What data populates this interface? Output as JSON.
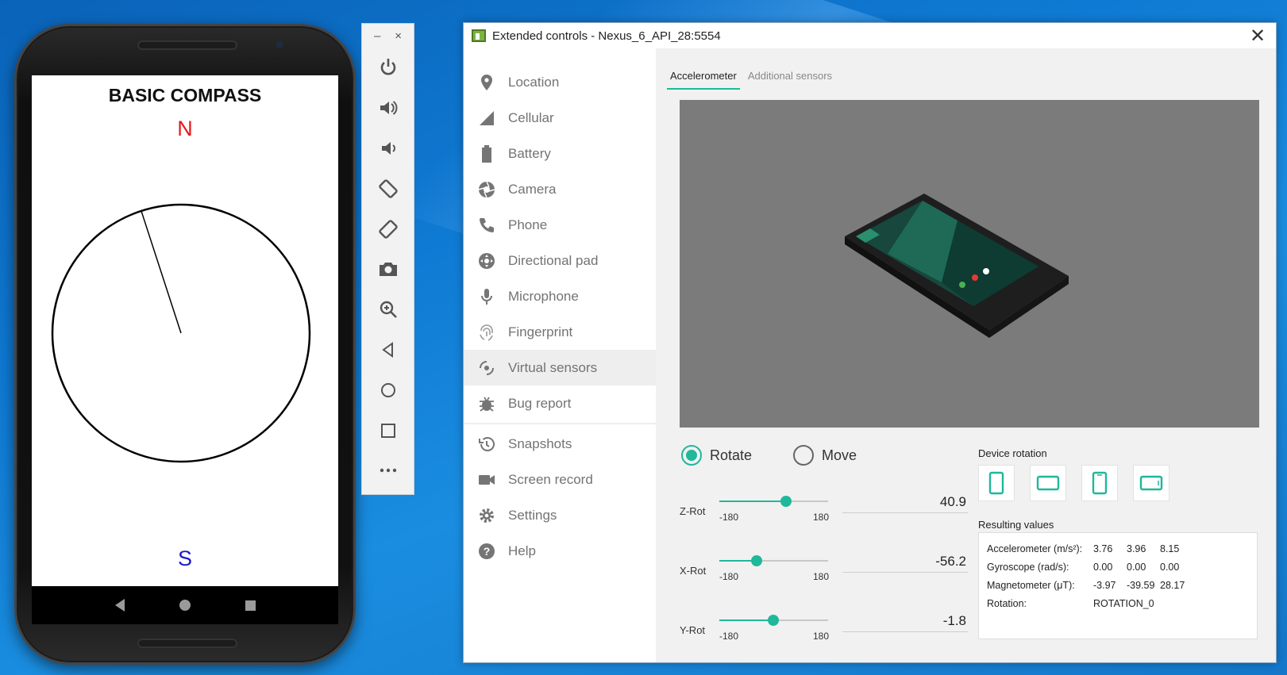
{
  "phone": {
    "app_title": "BASIC COMPASS",
    "north_label": "N",
    "south_label": "S",
    "compass_heading_deg": -18
  },
  "emulator_toolbar": {
    "minimize": "–",
    "close": "×",
    "buttons": [
      "power-icon",
      "volume-up-icon",
      "volume-down-icon",
      "rotate-left-icon",
      "rotate-right-icon",
      "camera-icon",
      "zoom-icon",
      "back-icon",
      "home-icon",
      "overview-icon",
      "more-icon"
    ]
  },
  "window": {
    "title": "Extended controls - Nexus_6_API_28:5554",
    "close": "✕"
  },
  "sidebar": {
    "items": [
      {
        "label": "Location",
        "icon": "location-pin-icon"
      },
      {
        "label": "Cellular",
        "icon": "signal-icon"
      },
      {
        "label": "Battery",
        "icon": "battery-icon"
      },
      {
        "label": "Camera",
        "icon": "aperture-icon"
      },
      {
        "label": "Phone",
        "icon": "phone-icon"
      },
      {
        "label": "Directional pad",
        "icon": "dpad-icon"
      },
      {
        "label": "Microphone",
        "icon": "microphone-icon"
      },
      {
        "label": "Fingerprint",
        "icon": "fingerprint-icon"
      },
      {
        "label": "Virtual sensors",
        "icon": "sensor-icon"
      },
      {
        "label": "Bug report",
        "icon": "bug-icon"
      },
      {
        "label": "Snapshots",
        "icon": "history-icon"
      },
      {
        "label": "Screen record",
        "icon": "video-icon"
      },
      {
        "label": "Settings",
        "icon": "gear-icon"
      },
      {
        "label": "Help",
        "icon": "help-icon"
      }
    ]
  },
  "tabs": {
    "accelerometer": "Accelerometer",
    "additional": "Additional sensors"
  },
  "mode": {
    "rotate": "Rotate",
    "move": "Move",
    "selected": "rotate"
  },
  "sliders": [
    {
      "label": "Z-Rot",
      "min": "-180",
      "max": "180",
      "value": "40.9"
    },
    {
      "label": "X-Rot",
      "min": "-180",
      "max": "180",
      "value": "-56.2"
    },
    {
      "label": "Y-Rot",
      "min": "-180",
      "max": "180",
      "value": "-1.8"
    }
  ],
  "device_rotation": {
    "title": "Device rotation"
  },
  "results": {
    "title": "Resulting values",
    "accelerometer": {
      "label": "Accelerometer (m/s²):",
      "v": [
        "3.76",
        "3.96",
        "8.15"
      ]
    },
    "gyroscope": {
      "label": "Gyroscope (rad/s):",
      "v": [
        "0.00",
        "0.00",
        "0.00"
      ]
    },
    "magnetometer": {
      "label": "Magnetometer (μT):",
      "v": [
        "-3.97",
        "-39.59",
        "28.17"
      ]
    },
    "rotation": {
      "label": "Rotation:",
      "value": "ROTATION_0"
    }
  },
  "colors": {
    "accent": "#1fb89a",
    "north": "#e31b1b",
    "south": "#1a1acf"
  }
}
